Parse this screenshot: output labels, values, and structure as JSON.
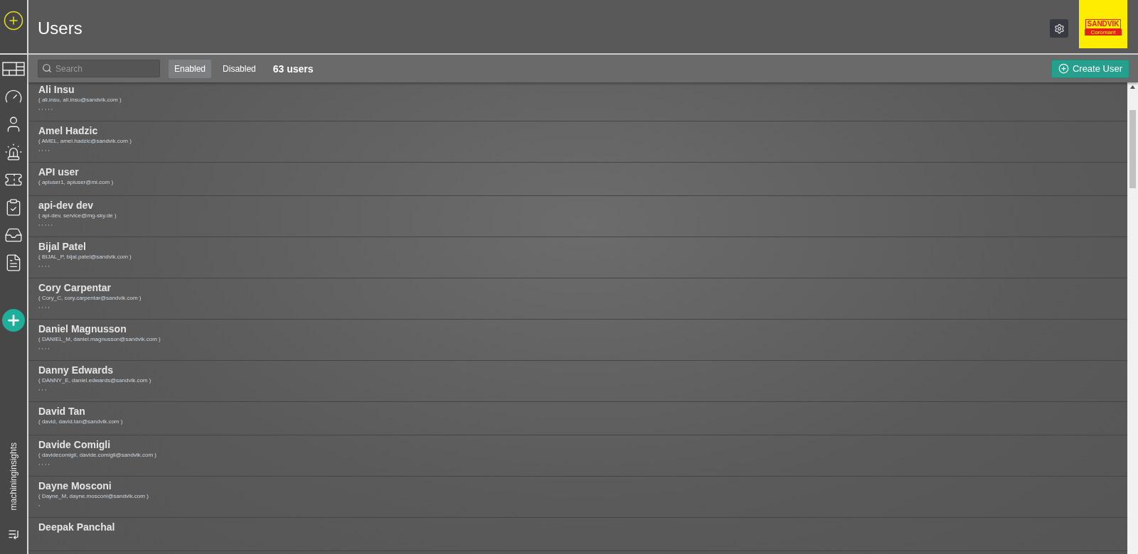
{
  "header": {
    "title": "Users",
    "logo": {
      "brand": "SANDVIK",
      "sub": "Coromant"
    }
  },
  "sidebar": {
    "app_name": "machininginsights"
  },
  "toolbar": {
    "search": {
      "placeholder": "Search"
    },
    "tabs": [
      {
        "label": "Enabled",
        "selected": true
      },
      {
        "label": "Disabled",
        "selected": false
      }
    ],
    "count": "63 users",
    "create_button": "Create User"
  },
  "users": [
    {
      "name": "Ali Insu",
      "login": "( ali.insu, ali.insu@sandvik.com )",
      "extra": ", , , , ,"
    },
    {
      "name": "Amel Hadzic",
      "login": "( AMEL, amel.hadzic@sandvik.com )",
      "extra": ", , , ,"
    },
    {
      "name": "API user",
      "login": "( apiuser1, apiuser@mi.com )"
    },
    {
      "name": "api-dev dev",
      "login": "( api-dev, service@mg-sky.de )",
      "extra": ", , , , ,"
    },
    {
      "name": "Bijal Patel",
      "login": "( BIJAL_P, bijal.patel@sandvik.com )",
      "extra": ", , , ,"
    },
    {
      "name": "Cory Carpentar",
      "login": "( Cory_C, cory.carpentar@sandvik.com )",
      "extra": ", , , ,"
    },
    {
      "name": "Daniel Magnusson",
      "login": "( DANIEL_M, daniel.magnusson@sandvik.com )",
      "extra": ", , , ,"
    },
    {
      "name": "Danny Edwards",
      "login": "( DANNY_E, daniel.edwards@sandvik.com )",
      "extra": ", , ,"
    },
    {
      "name": "David Tan",
      "login": "( david, david.tan@sandvik.com )"
    },
    {
      "name": "Davide Comigli",
      "login": "( davidecomigli, davide.comigli@sandvik.com )",
      "extra": ", , , ,"
    },
    {
      "name": "Dayne Mosconi",
      "login": "( Dayne_M, dayne.mosconi@sandvik.com )",
      "extra": ","
    },
    {
      "name": "Deepak Panchal"
    }
  ]
}
